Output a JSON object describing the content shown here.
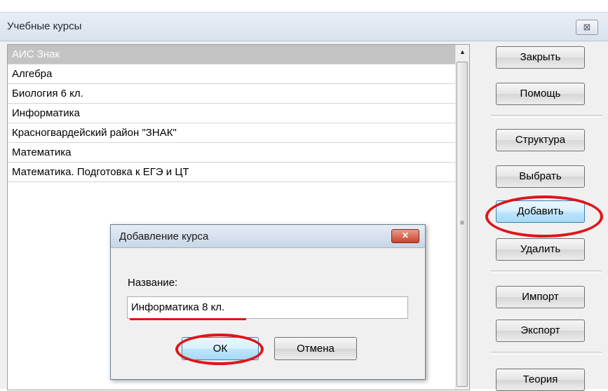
{
  "window": {
    "title": "Учебные курсы",
    "close_label": "⊠"
  },
  "list": {
    "items": [
      {
        "label": "АИС Знак",
        "selected": true
      },
      {
        "label": "Алгебра"
      },
      {
        "label": "Биология 6 кл."
      },
      {
        "label": "Информатика"
      },
      {
        "label": "Красногвардейский район \"ЗНАК\""
      },
      {
        "label": "Математика"
      },
      {
        "label": "Математика. Подготовка к ЕГЭ и ЦТ"
      }
    ],
    "scroll_up_glyph": "▲",
    "thumb_grip": "≡"
  },
  "buttons": {
    "close": "Закрыть",
    "help": "Помощь",
    "structure": "Структура",
    "select": "Выбрать",
    "add": "Добавить",
    "delete": "Удалить",
    "import": "Импорт",
    "export": "Экспорт",
    "theory": "Теория"
  },
  "dialog": {
    "title": "Добавление курса",
    "close_label": "✕",
    "name_label": "Название:",
    "name_value": "Информатика 8 кл.",
    "ok_label": "ОК",
    "cancel_label": "Отмена"
  },
  "colors": {
    "annotation_red": "#e0141a",
    "selected_row": "#c3c3c3"
  }
}
